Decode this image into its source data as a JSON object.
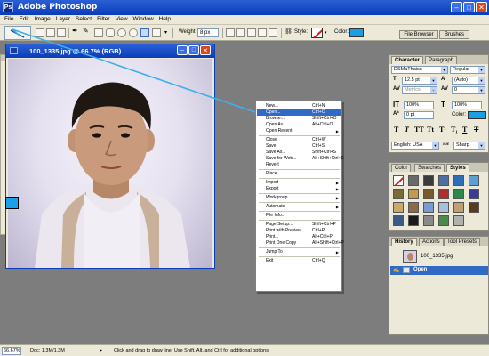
{
  "app": {
    "title": "Adobe Photoshop",
    "icon": "Ps"
  },
  "window_buttons": {
    "minimize": "–",
    "maximize": "□",
    "close": "✕"
  },
  "menubar": [
    "File",
    "Edit",
    "Image",
    "Layer",
    "Select",
    "Filter",
    "View",
    "Window",
    "Help"
  ],
  "options_bar": {
    "active_tool": "line-tool",
    "weight_label": "Weight:",
    "weight_value": "8 px",
    "style_label": "Style:",
    "color_label": "Color:",
    "color_value": "#1a9fe6",
    "file_browser_tab": "File Browser",
    "brushes_tab": "Brushes"
  },
  "toolbox": {
    "tools": [
      "marquee",
      "move",
      "lasso",
      "magic-wand",
      "crop",
      "slice",
      "healing",
      "brush",
      "stamp",
      "history-brush",
      "eraser",
      "gradient",
      "blur",
      "dodge",
      "path-select",
      "type",
      "pen",
      "line",
      "notes",
      "eyedropper",
      "hand",
      "zoom"
    ],
    "foreground_color": "#1aa0e8",
    "background_color": "#ffffff"
  },
  "document": {
    "title": "100_1335.jpg @ 66.7% (RGB)"
  },
  "context_menu": [
    {
      "label": "New...",
      "shortcut": "Ctrl+N"
    },
    {
      "label": "Open...",
      "shortcut": "Ctrl+O",
      "highlight": true
    },
    {
      "label": "Browse...",
      "shortcut": "Shift+Ctrl+O"
    },
    {
      "label": "Open As...",
      "shortcut": "Alt+Ctrl+O"
    },
    {
      "label": "Open Recent",
      "submenu": true
    },
    {
      "sep": true
    },
    {
      "label": "Close",
      "shortcut": "Ctrl+W"
    },
    {
      "label": "Save",
      "shortcut": "Ctrl+S"
    },
    {
      "label": "Save As...",
      "shortcut": "Shift+Ctrl+S"
    },
    {
      "label": "Save for Web...",
      "shortcut": "Alt+Shift+Ctrl+S"
    },
    {
      "label": "Revert"
    },
    {
      "sep": true
    },
    {
      "label": "Place..."
    },
    {
      "sep": true
    },
    {
      "label": "Import",
      "submenu": true
    },
    {
      "label": "Export",
      "submenu": true
    },
    {
      "sep": true
    },
    {
      "label": "Workgroup",
      "submenu": true
    },
    {
      "sep": true
    },
    {
      "label": "Automate",
      "submenu": true
    },
    {
      "sep": true
    },
    {
      "label": "File Info..."
    },
    {
      "sep": true
    },
    {
      "label": "Page Setup...",
      "shortcut": "Shift+Ctrl+P"
    },
    {
      "label": "Print with Preview...",
      "shortcut": "Ctrl+P"
    },
    {
      "label": "Print...",
      "shortcut": "Alt+Ctrl+P"
    },
    {
      "label": "Print One Copy",
      "shortcut": "Alt+Shift+Ctrl+P"
    },
    {
      "sep": true
    },
    {
      "label": "Jump To",
      "submenu": true
    },
    {
      "sep": true
    },
    {
      "label": "Exit",
      "shortcut": "Ctrl+Q"
    }
  ],
  "character_panel": {
    "tabs": [
      "Character",
      "Paragraph"
    ],
    "font_family": "DSMaThaiso",
    "font_style": "Regular",
    "font_size": "12.5 pt",
    "leading": "(Auto)",
    "kerning": "Metrics",
    "tracking": "0",
    "vertical_scale": "100%",
    "horizontal_scale": "100%",
    "baseline_shift": "0 pt",
    "color_label": "Color:",
    "color_value": "#1a9fe6",
    "format_buttons": [
      "T",
      "T",
      "TT",
      "Tt",
      "T¹",
      "T₁",
      "T",
      "T"
    ],
    "language": "English: USA",
    "aa_label": "aa",
    "antialias": "Sharp"
  },
  "styles_panel": {
    "tabs": [
      "Color",
      "Swatches",
      "Styles"
    ],
    "swatches": [
      "#ffffff",
      "#6a6a6a",
      "#3b3b3b",
      "#4a6fa5",
      "#2c6fb8",
      "#5a9fd6",
      "#7a6a3a",
      "#c49a4a",
      "#7a5a2a",
      "#b52a2a",
      "#2a8a4a",
      "#3a3a9a",
      "#c9a86a",
      "#8a6a4a",
      "#7a9ad6",
      "#a8c0e0",
      "#c0a070",
      "#5a3a1a",
      "#3a5a8a",
      "#1a1a1a",
      "#8a8a8a",
      "#4a8a4a",
      "#b0b0b0"
    ]
  },
  "history_panel": {
    "tabs": [
      "History",
      "Actions",
      "Tool Presets"
    ],
    "snapshot": "100_1335.jpg",
    "state": "Open"
  },
  "status": {
    "zoom": "66.67%",
    "doc_label": "Doc: 1.3M/1.3M",
    "hint": "Click and drag to draw line.  Use Shift, Alt, and Ctrl for additional options."
  }
}
